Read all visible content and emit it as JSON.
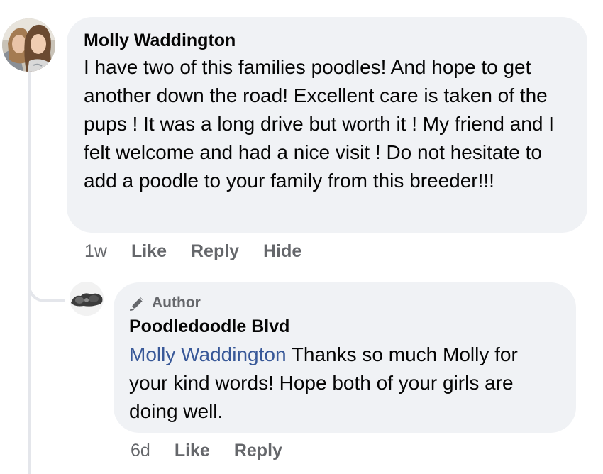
{
  "comment": {
    "author": "Molly Waddington",
    "text": "I have two of this families poodles! And hope to get another down the road! Excellent care is taken of the pups ! It was a long drive but worth it ! My friend and I felt welcome and had a nice visit ! Do not hesitate to add a poodle to your family from this breeder!!!",
    "time": "1w",
    "like_label": "Like",
    "reply_label": "Reply",
    "hide_label": "Hide"
  },
  "reply": {
    "badge": "Author",
    "author": "Poodledoodle Blvd",
    "mention": "Molly Waddington",
    "text": " Thanks so much Molly for your kind words! Hope both of your girls are doing well.",
    "time": "6d",
    "like_label": "Like",
    "reply_label": "Reply"
  },
  "colors": {
    "bubble_bg": "#f0f2f5",
    "text": "#050505",
    "secondary": "#65676b",
    "mention": "#385898",
    "thread_line": "#e4e6eb"
  },
  "icons": {
    "author_badge": "pen-icon"
  }
}
